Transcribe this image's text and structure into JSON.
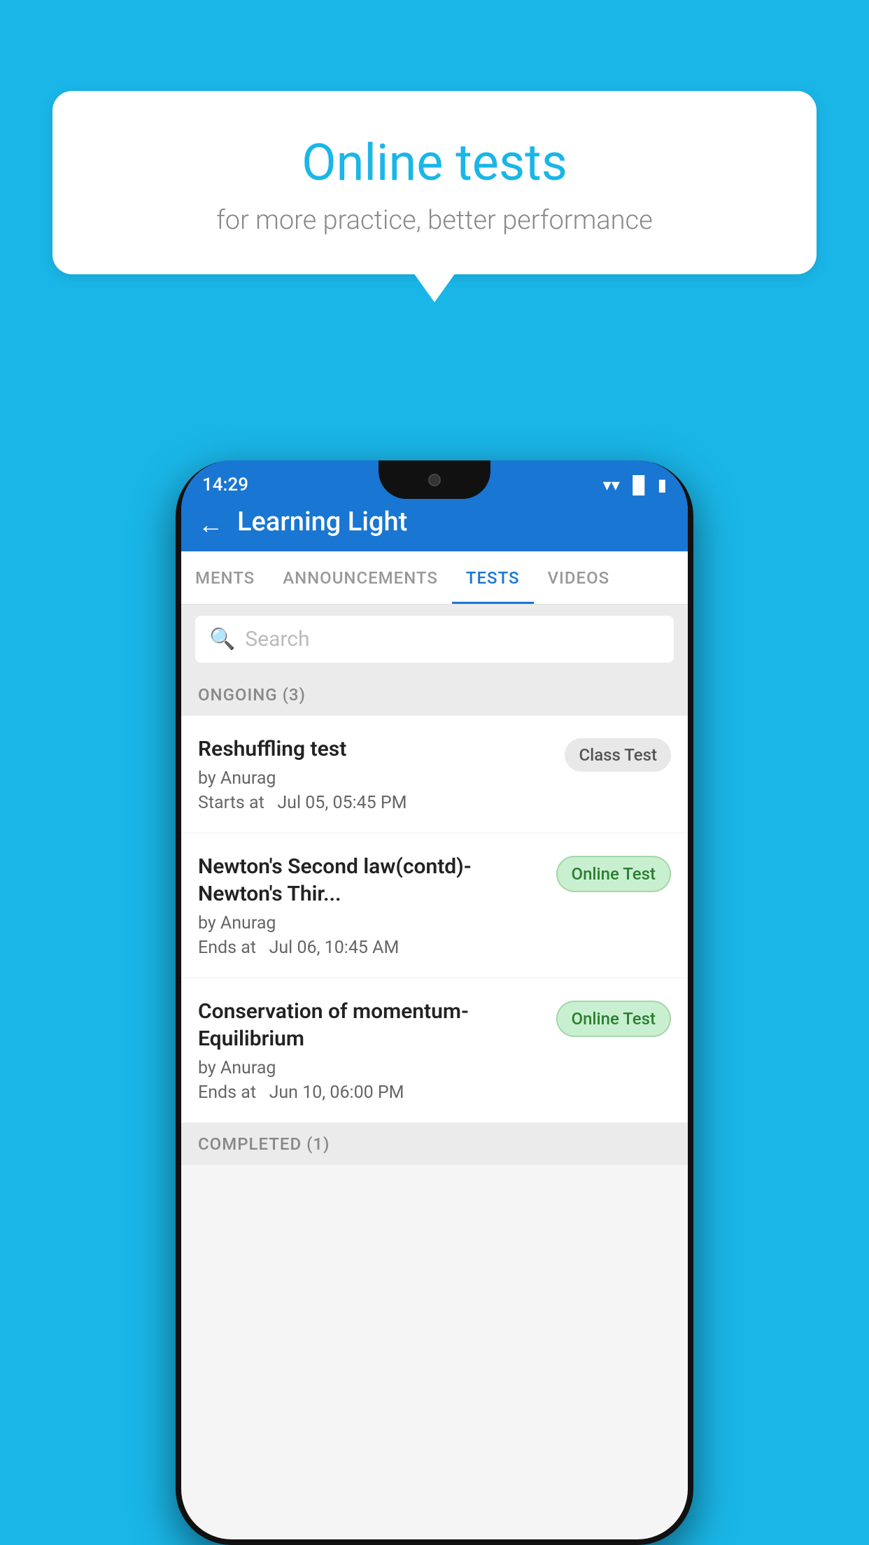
{
  "background_color": "#1ab6e8",
  "bubble": {
    "title": "Online tests",
    "subtitle": "for more practice, better performance"
  },
  "phone": {
    "status_bar": {
      "time": "14:29",
      "icons": [
        "wifi",
        "signal",
        "battery"
      ]
    },
    "header": {
      "back_label": "←",
      "title": "Learning Light"
    },
    "tabs": [
      {
        "label": "MENTS",
        "active": false
      },
      {
        "label": "ANNOUNCEMENTS",
        "active": false
      },
      {
        "label": "TESTS",
        "active": true
      },
      {
        "label": "VIDEOS",
        "active": false
      }
    ],
    "search": {
      "placeholder": "Search"
    },
    "ongoing_section": {
      "label": "ONGOING (3)"
    },
    "tests": [
      {
        "name": "Reshuffling test",
        "author": "by Anurag",
        "time_label": "Starts at",
        "time_value": "Jul 05, 05:45 PM",
        "badge": "Class Test",
        "badge_type": "class"
      },
      {
        "name": "Newton's Second law(contd)-Newton's Thir...",
        "author": "by Anurag",
        "time_label": "Ends at",
        "time_value": "Jul 06, 10:45 AM",
        "badge": "Online Test",
        "badge_type": "online"
      },
      {
        "name": "Conservation of momentum-Equilibrium",
        "author": "by Anurag",
        "time_label": "Ends at",
        "time_value": "Jun 10, 06:00 PM",
        "badge": "Online Test",
        "badge_type": "online"
      }
    ],
    "completed_section": {
      "label": "COMPLETED (1)"
    }
  }
}
